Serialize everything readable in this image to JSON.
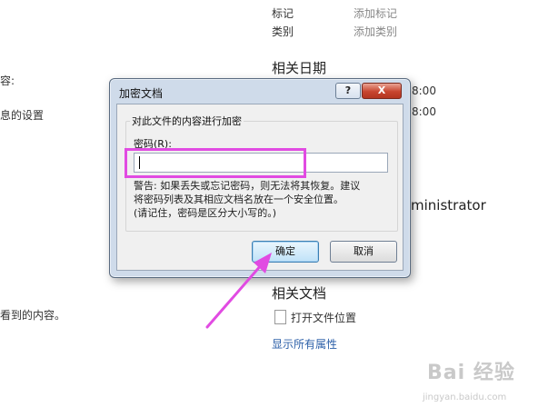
{
  "left_panel": {
    "line1": "容:",
    "line2": "息的设置",
    "line3": "看到的内容。"
  },
  "right_panel": {
    "tags_label": "标记",
    "tags_value": "添加标记",
    "category_label": "类别",
    "category_value": "添加类别",
    "dates_header": "相关日期",
    "time1": "8:00",
    "time2": "8:00",
    "author": "ministrator",
    "docs_header": "相关文档",
    "open_location": "打开文件位置",
    "show_all": "显示所有属性"
  },
  "dialog": {
    "title": "加密文档",
    "help_glyph": "?",
    "close_glyph": "X",
    "group_label": "对此文件的内容进行加密",
    "password_label": "密码(R):",
    "password_value": "",
    "warning": "警告: 如果丢失或忘记密码，则无法将其恢复。建议\n将密码列表及其相应文档名放在一个安全位置。\n(请记住，密码是区分大小写的。)",
    "ok_label": "确定",
    "cancel_label": "取消"
  },
  "annotations": {
    "highlight_color": "#e14be2",
    "arrow_color": "#e14be2"
  },
  "watermark": {
    "text": "Bai 经验",
    "url": "jingyan.baidu.com"
  }
}
